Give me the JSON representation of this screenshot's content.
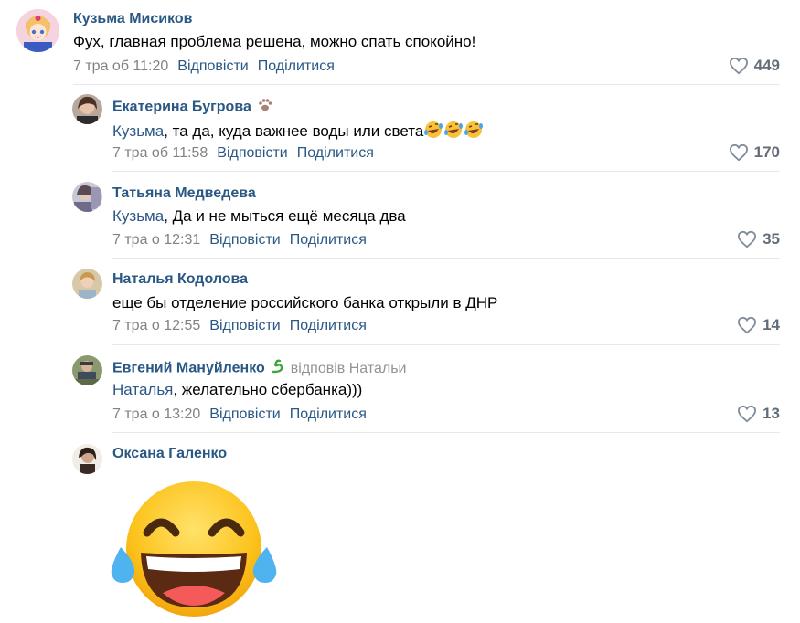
{
  "comments": [
    {
      "author": "Кузьма Мисиков",
      "text": "Фух, главная проблема решена, можно спать спокойно!",
      "date": "7 тра об 11:20",
      "reply": "Відповісти",
      "share": "Поділитися",
      "likes": "449"
    },
    {
      "author": "Екатерина Бугрова",
      "mention": "Кузьма",
      "text": ", та да, куда важнее воды или света",
      "date": "7 тра об 11:58",
      "reply": "Відповісти",
      "share": "Поділитися",
      "likes": "170"
    },
    {
      "author": "Татьяна Медведева",
      "mention": "Кузьма",
      "text": ", Да и не мыться ещё месяца два",
      "date": "7 тра о 12:31",
      "reply": "Відповісти",
      "share": "Поділитися",
      "likes": "35"
    },
    {
      "author": "Наталья Кодолова",
      "text": "еще бы отделение российского банка открыли в ДНР",
      "date": "7 тра о 12:55",
      "reply": "Відповісти",
      "share": "Поділитися",
      "likes": "14"
    },
    {
      "author": "Евгений Мануйленко",
      "reply_to": "відповів Натальи",
      "mention": "Наталья",
      "text": ", желательно сбербанка)))",
      "date": "7 тра о 13:20",
      "reply": "Відповісти",
      "share": "Поділитися",
      "likes": "13"
    },
    {
      "author": "Оксана Галенко",
      "sticker": "laughing-tears-emoji"
    }
  ],
  "colors": {
    "link": "#2a5885",
    "meta": "#828282",
    "divider": "#e7e8ec",
    "likes": "#626d7a"
  }
}
